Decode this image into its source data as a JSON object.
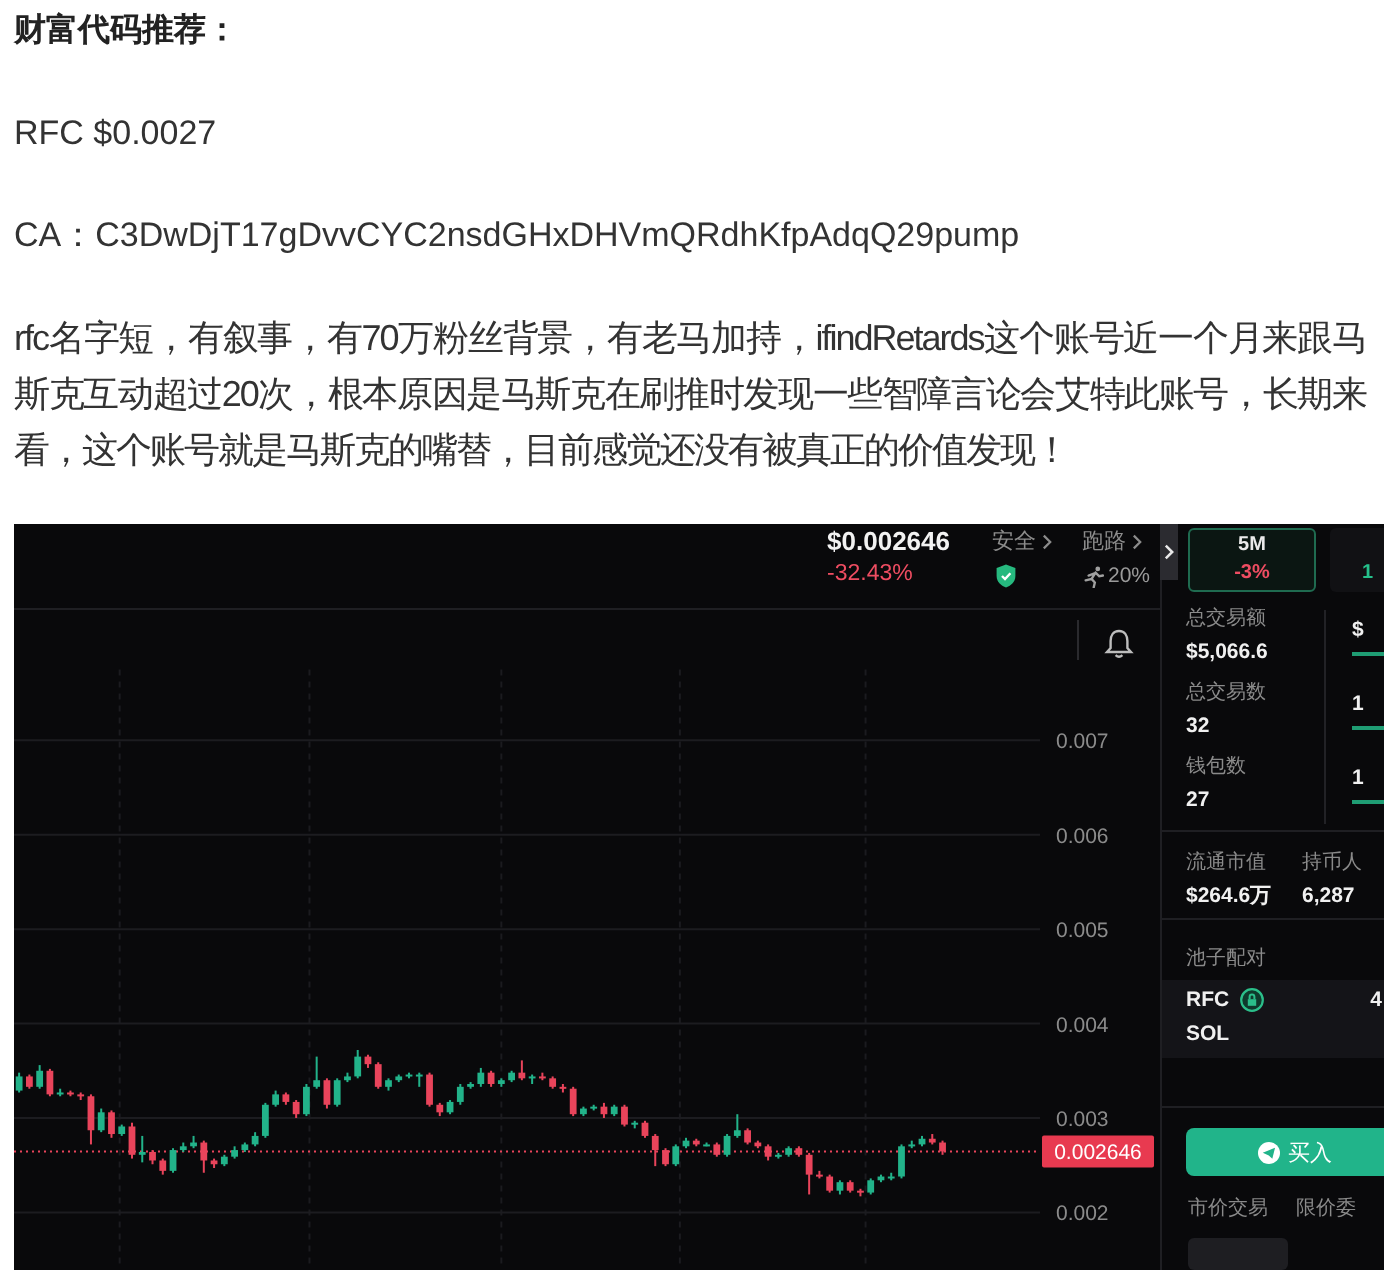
{
  "article": {
    "heading": "财富代码推荐：",
    "ticker_line": "RFC $0.0027",
    "contract_line": "CA：C3DwDjT17gDvvCYC2nsdGHxDHVmQRdhKfpAdqQ29pump",
    "paragraph": "rfc名字短，有叙事，有70万粉丝背景，有老马加持，ifindRetards这个账号近一个月来跟马斯克互动超过20次，根本原因是马斯克在刷推时发现一些智障言论会艾特此账号，长期来看，这个账号就是马斯克的嘴替，目前感觉还没有被真正的价值发现！"
  },
  "trading_screenshot": {
    "header": {
      "price": "$0.002646",
      "change": "-32.43%",
      "safety": "安全",
      "rug_risk": "跑路",
      "rug_risk_value": "20%"
    },
    "chart_data": {
      "type": "candlestick",
      "grid": true,
      "ylim": [
        0.0014,
        0.00775
      ],
      "categories": [
        null,
        null,
        null,
        null,
        null,
        null,
        null,
        null,
        null,
        null,
        null,
        null,
        null,
        null,
        null,
        null,
        null,
        null,
        null,
        null,
        null,
        null,
        null,
        null,
        null,
        null,
        null,
        null,
        null,
        null,
        null,
        null,
        null,
        null,
        null,
        null,
        null,
        null,
        null,
        null,
        null,
        null,
        null,
        null,
        null,
        null,
        null,
        null,
        null,
        null,
        null,
        null,
        null,
        null,
        null,
        null,
        null,
        null,
        null,
        null,
        null,
        null,
        null,
        null,
        null,
        null,
        null,
        null,
        null,
        null,
        null,
        null,
        null,
        null,
        null,
        null,
        null,
        null,
        null,
        null,
        null,
        null,
        null,
        null,
        null,
        null,
        null,
        null,
        null,
        null,
        null,
        null,
        null,
        null,
        null,
        null,
        null,
        null,
        null,
        null
      ],
      "ohlc": [
        [
          0.00329,
          0.00348,
          0.00327,
          0.00344
        ],
        [
          0.00344,
          0.00346,
          0.00331,
          0.00333
        ],
        [
          0.00333,
          0.00356,
          0.00331,
          0.0035
        ],
        [
          0.0035,
          0.00352,
          0.00323,
          0.00325
        ],
        [
          0.00325,
          0.00331,
          0.00323,
          0.00327
        ],
        [
          0.00327,
          0.00329,
          0.00323,
          0.00325
        ],
        [
          0.00325,
          0.00327,
          0.00319,
          0.00323
        ],
        [
          0.00323,
          0.00325,
          0.00272,
          0.00287
        ],
        [
          0.00287,
          0.0031,
          0.00285,
          0.00306
        ],
        [
          0.00306,
          0.00308,
          0.00279,
          0.00283
        ],
        [
          0.00283,
          0.00293,
          0.00281,
          0.00291
        ],
        [
          0.00291,
          0.00295,
          0.00257,
          0.00261
        ],
        [
          0.00261,
          0.00281,
          0.00253,
          0.00264
        ],
        [
          0.00264,
          0.00266,
          0.00251,
          0.00255
        ],
        [
          0.00255,
          0.00257,
          0.0024,
          0.00244
        ],
        [
          0.00244,
          0.00268,
          0.00242,
          0.00266
        ],
        [
          0.00266,
          0.00274,
          0.00264,
          0.0027
        ],
        [
          0.0027,
          0.00281,
          0.00268,
          0.00274
        ],
        [
          0.00274,
          0.00276,
          0.00242,
          0.00255
        ],
        [
          0.00255,
          0.00257,
          0.00247,
          0.00251
        ],
        [
          0.00251,
          0.00261,
          0.00249,
          0.00259
        ],
        [
          0.00259,
          0.0027,
          0.00257,
          0.00266
        ],
        [
          0.00266,
          0.00274,
          0.00264,
          0.00272
        ],
        [
          0.00272,
          0.00285,
          0.0027,
          0.00281
        ],
        [
          0.00281,
          0.00316,
          0.00279,
          0.00314
        ],
        [
          0.00314,
          0.00329,
          0.00312,
          0.00325
        ],
        [
          0.00325,
          0.00327,
          0.00314,
          0.00317
        ],
        [
          0.00317,
          0.00319,
          0.003,
          0.00304
        ],
        [
          0.00304,
          0.00336,
          0.00302,
          0.00333
        ],
        [
          0.00333,
          0.00365,
          0.00331,
          0.0034
        ],
        [
          0.0034,
          0.00342,
          0.0031,
          0.00314
        ],
        [
          0.00314,
          0.00342,
          0.00312,
          0.0034
        ],
        [
          0.0034,
          0.00348,
          0.00338,
          0.00344
        ],
        [
          0.00344,
          0.00372,
          0.00342,
          0.00365
        ],
        [
          0.00365,
          0.00367,
          0.00353,
          0.00357
        ],
        [
          0.00357,
          0.00359,
          0.00331,
          0.00333
        ],
        [
          0.00333,
          0.00342,
          0.00329,
          0.0034
        ],
        [
          0.0034,
          0.00346,
          0.00338,
          0.00344
        ],
        [
          0.00344,
          0.00348,
          0.00342,
          0.00346
        ],
        [
          0.00346,
          0.00348,
          0.00333,
          0.00346
        ],
        [
          0.00346,
          0.00348,
          0.00312,
          0.00314
        ],
        [
          0.00314,
          0.00316,
          0.00302,
          0.00306
        ],
        [
          0.00306,
          0.00319,
          0.00304,
          0.00317
        ],
        [
          0.00317,
          0.00336,
          0.00314,
          0.00333
        ],
        [
          0.00333,
          0.00338,
          0.00331,
          0.00336
        ],
        [
          0.00336,
          0.00353,
          0.00333,
          0.00348
        ],
        [
          0.00348,
          0.0035,
          0.00333,
          0.00336
        ],
        [
          0.00336,
          0.00342,
          0.00333,
          0.0034
        ],
        [
          0.0034,
          0.0035,
          0.00338,
          0.00348
        ],
        [
          0.00348,
          0.00361,
          0.0034,
          0.00342
        ],
        [
          0.00342,
          0.00346,
          0.00336,
          0.00344
        ],
        [
          0.00344,
          0.00348,
          0.0034,
          0.00342
        ],
        [
          0.00342,
          0.00344,
          0.00331,
          0.00333
        ],
        [
          0.00333,
          0.00336,
          0.00327,
          0.00331
        ],
        [
          0.00331,
          0.00333,
          0.00302,
          0.00304
        ],
        [
          0.00304,
          0.00312,
          0.00302,
          0.0031
        ],
        [
          0.0031,
          0.00314,
          0.00308,
          0.00312
        ],
        [
          0.00312,
          0.00316,
          0.003,
          0.00304
        ],
        [
          0.00304,
          0.00314,
          0.00302,
          0.00312
        ],
        [
          0.00312,
          0.00314,
          0.00291,
          0.00293
        ],
        [
          0.00293,
          0.00297,
          0.00289,
          0.00295
        ],
        [
          0.00295,
          0.00297,
          0.00279,
          0.00281
        ],
        [
          0.00281,
          0.00283,
          0.00249,
          0.00266
        ],
        [
          0.00266,
          0.00268,
          0.00249,
          0.00251
        ],
        [
          0.00251,
          0.00272,
          0.00249,
          0.0027
        ],
        [
          0.0027,
          0.00279,
          0.00268,
          0.00276
        ],
        [
          0.00276,
          0.00278,
          0.0027,
          0.00272
        ],
        [
          0.00272,
          0.00274,
          0.0027,
          0.00272
        ],
        [
          0.00272,
          0.00274,
          0.00259,
          0.00261
        ],
        [
          0.00261,
          0.00283,
          0.00259,
          0.00281
        ],
        [
          0.00281,
          0.00304,
          0.00279,
          0.00287
        ],
        [
          0.00287,
          0.00289,
          0.00272,
          0.00274
        ],
        [
          0.00274,
          0.00276,
          0.00268,
          0.0027
        ],
        [
          0.0027,
          0.00272,
          0.00255,
          0.00259
        ],
        [
          0.00259,
          0.00263,
          0.00257,
          0.00261
        ],
        [
          0.00261,
          0.0027,
          0.00259,
          0.00268
        ],
        [
          0.00268,
          0.0027,
          0.00259,
          0.00261
        ],
        [
          0.00261,
          0.00263,
          0.00219,
          0.0024
        ],
        [
          0.0024,
          0.00244,
          0.00236,
          0.00238
        ],
        [
          0.00238,
          0.0024,
          0.00221,
          0.00223
        ],
        [
          0.00223,
          0.00234,
          0.00219,
          0.00232
        ],
        [
          0.00232,
          0.00234,
          0.00221,
          0.00223
        ],
        [
          0.00223,
          0.00225,
          0.00217,
          0.00221
        ],
        [
          0.00221,
          0.00236,
          0.00219,
          0.00234
        ],
        [
          0.00234,
          0.0024,
          0.00232,
          0.00238
        ],
        [
          0.00238,
          0.00242,
          0.00234,
          0.00238
        ],
        [
          0.00238,
          0.00272,
          0.00236,
          0.0027
        ],
        [
          0.0027,
          0.00276,
          0.00268,
          0.00272
        ],
        [
          0.00272,
          0.00281,
          0.0027,
          0.00278
        ],
        [
          0.00278,
          0.00283,
          0.00272,
          0.00274
        ],
        [
          0.00274,
          0.00276,
          0.00261,
          0.002646
        ],
        null,
        null,
        null,
        null,
        null,
        null,
        null,
        null,
        null
      ],
      "yticks": [
        0.007,
        0.006,
        0.005,
        0.004,
        0.003,
        0.002
      ],
      "ref_lines": [
        {
          "axis": "y",
          "value": 0.002646,
          "label": "0.002646"
        }
      ]
    },
    "timeframe_tabs": [
      {
        "label": "5M",
        "change": "-3%",
        "color": "#ef4d62",
        "selected": true
      },
      {
        "change": "1",
        "color": "#25c08b",
        "selected": false
      }
    ],
    "stats": [
      {
        "label": "总交易额",
        "value": "$5,066.6",
        "column_2": "$"
      },
      {
        "label": "总交易数",
        "value": "32",
        "column_2": "1"
      },
      {
        "label": "钱包数",
        "value": "27",
        "column_2": "1"
      }
    ],
    "market": [
      {
        "label": "流通市值",
        "value": "$264.6万"
      },
      {
        "label": "持币人",
        "value": "6,287"
      }
    ],
    "pool": {
      "title": "池子配对",
      "pair": [
        "RFC",
        "SOL"
      ],
      "column_2": "4"
    },
    "buy_button": "买入",
    "order_tabs": [
      "市价交易",
      "限价委"
    ]
  }
}
